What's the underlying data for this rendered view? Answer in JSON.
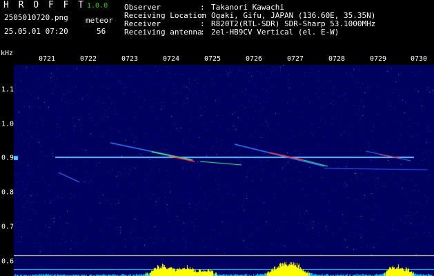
{
  "header": {
    "title": "H R O F F T",
    "version": "1.0.0",
    "filename": "2505010720.png",
    "datetime": "25.05.01 07:20",
    "meteor_label": "meteor",
    "meteor_count": "56"
  },
  "info": [
    {
      "key": "Observer",
      "value": "Takanori Kawachi"
    },
    {
      "key": "Receiving Location",
      "value": "Ogaki, Gifu, JAPAN (136.60E, 35.35N)"
    },
    {
      "key": "Receiver",
      "value": "R820T2(RTL-SDR) SDR-Sharp 53.1000MHz"
    },
    {
      "key": "Receiving antenna",
      "value": "2el-HB9CV Vertical (el. E-W)"
    }
  ],
  "axis": {
    "unit": "kHz",
    "time_ticks": [
      "0721",
      "0722",
      "0723",
      "0724",
      "0725",
      "0726",
      "0727",
      "0728",
      "0729",
      "0730"
    ],
    "freq_ticks": [
      "1.1",
      "1.0",
      "0.9",
      "0.8",
      "0.7",
      "0.6"
    ]
  },
  "colors": {
    "background": "#000000",
    "noise_base": "#000060",
    "carrier": "#60c0ff",
    "echo_core": "#ff4040",
    "echo_mid": "#40ff80",
    "reference_line": "#ffff80",
    "bottom_band": "#00e0ff",
    "activity_fill": "#ffff00"
  }
}
